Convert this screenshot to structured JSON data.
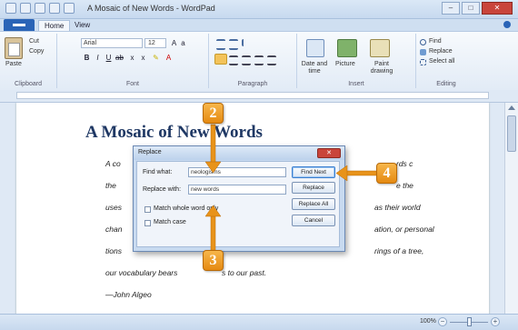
{
  "window": {
    "title": "A Mosaic of New Words - WordPad",
    "close_label": "✕",
    "min_label": "–",
    "max_label": "□"
  },
  "tabs": {
    "home": "Home",
    "view": "View"
  },
  "ribbon": {
    "clipboard": {
      "label": "Clipboard",
      "paste": "Paste",
      "cut": "Cut",
      "copy": "Copy"
    },
    "font": {
      "label": "Font",
      "name": "Arial",
      "size": "12",
      "bold": "B",
      "italic": "I",
      "underline": "U"
    },
    "paragraph": {
      "label": "Paragraph"
    },
    "insert": {
      "label": "Insert",
      "datetime": "Date and time",
      "picture": "Picture",
      "paint": "Paint drawing"
    },
    "editing": {
      "label": "Editing",
      "find": "Find",
      "replace": "Replace",
      "select_all": "Select all"
    }
  },
  "document": {
    "title": "A Mosaic of New Words",
    "lines": [
      "A co",
      "the",
      "uses",
      "chan",
      "tions",
      "our vocabulary bears",
      "—John Algeo"
    ],
    "right_fragments": [
      "rds c",
      "e the",
      "as their world",
      "ation, or personal",
      "rings of a tree,",
      "s to our past."
    ]
  },
  "dialog": {
    "title": "Replace",
    "close_label": "✕",
    "find_what_label": "Find what:",
    "find_what_value": "neologisms",
    "replace_with_label": "Replace with:",
    "replace_with_value": "new words",
    "match_whole_word": "Match whole word only",
    "match_case": "Match case",
    "buttons": {
      "find_next": "Find Next",
      "replace": "Replace",
      "replace_all": "Replace All",
      "cancel": "Cancel"
    }
  },
  "callouts": {
    "step2": "2",
    "step3": "3",
    "step4": "4"
  },
  "statusbar": {
    "zoom": "100%",
    "zoom_minus": "−",
    "zoom_plus": "+"
  },
  "colors": {
    "callout": "#e8931a",
    "title_text": "#1f3864",
    "close_red": "#c9453b"
  }
}
